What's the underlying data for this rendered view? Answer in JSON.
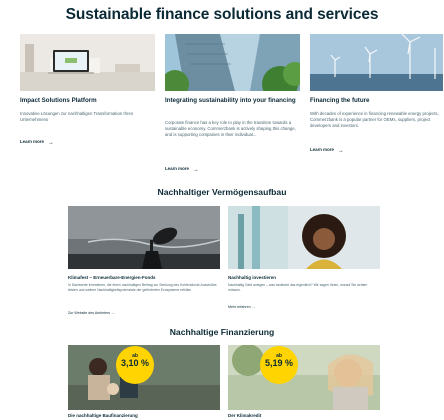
{
  "page": {
    "title": "Sustainable finance solutions and services"
  },
  "top_cards": [
    {
      "title": "Impact Solutions Platform",
      "text": "Innovative Lösungen zur nachhaltigen Transformation Ihres Unternehmens",
      "link": "Learn more"
    },
    {
      "title": "Integrating sustainability into your financing",
      "text": "Corporate finance has a key role to play in the transition towards a sustainable economy. Commerzbank is actively shaping this change, and is supporting companies in their individual...",
      "link": "Learn more"
    },
    {
      "title": "Financing the future",
      "text": "With decades of experience in financing renewable energy projects, Commerzbank is a popular partner for OEMs, suppliers, project developers and investors.",
      "link": "Learn more"
    }
  ],
  "section_wealth": {
    "heading": "Nachhaltiger Vermögensaufbau",
    "cards": [
      {
        "title": "Klimafest – Erneuerbare-Energien-Fonds",
        "text": "In Sachwerte investieren, die einen nachhaltigen Beitrag zur Senkung des Kohlendioxid-Ausstoßes leisten und weitere Nachhaltigkeitspotenziale der geförderten Ecosysteme erfüllen",
        "link": "Zur Website des Anbieters"
      },
      {
        "title": "Nachhaltig investieren",
        "text": "Nachhaltig Geld anlegen – was bedeutet das eigentlich? Wir sagen Ihnen, worauf Sie achten müssen.",
        "link": "Mehr erfahren"
      }
    ]
  },
  "section_financing": {
    "heading": "Nachhaltige Finanzierung",
    "cards": [
      {
        "badge_prefix": "ab",
        "badge_value": "3,10 %",
        "title": "Die nachhaltige Baufinanzierung"
      },
      {
        "badge_prefix": "ab",
        "badge_value": "5,19 %",
        "title": "Der Klimakredit"
      }
    ]
  },
  "colors": {
    "heading": "#0b2a36",
    "body_text": "#4a6670",
    "badge": "#ffd400"
  }
}
